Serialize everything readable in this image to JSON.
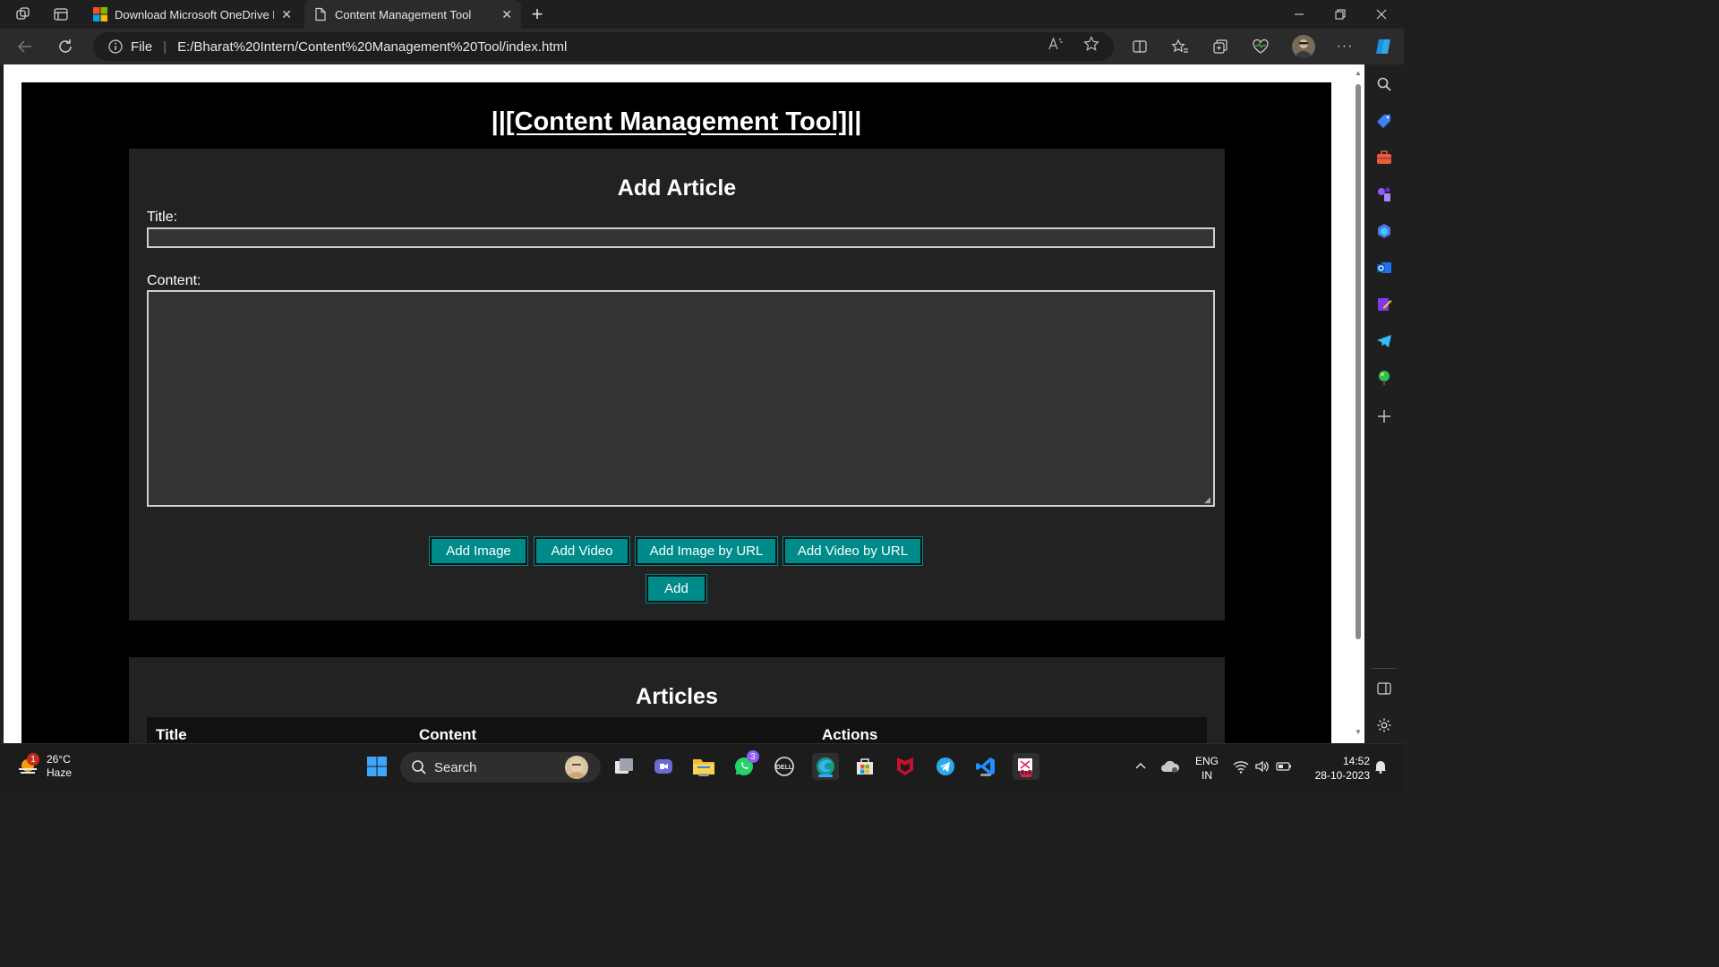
{
  "browser": {
    "tabs": [
      {
        "label": "Download Microsoft OneDrive M",
        "close": "✕",
        "active": false
      },
      {
        "label": "Content Management Tool",
        "close": "✕",
        "active": true
      }
    ],
    "new_tab": "+",
    "address": {
      "scheme_label": "File",
      "url": "E:/Bharat%20Intern/Content%20Management%20Tool/index.html"
    },
    "more_label": "···"
  },
  "page": {
    "site_title": "||[Content Management Tool]||",
    "form": {
      "heading": "Add Article",
      "title_label": "Title:",
      "title_value": "",
      "content_label": "Content:",
      "content_value": "",
      "buttons": {
        "add_image": "Add Image",
        "add_video": "Add Video",
        "add_image_url": "Add Image by URL",
        "add_video_url": "Add Video by URL",
        "add": "Add"
      }
    },
    "articles": {
      "heading": "Articles",
      "columns": [
        "Title",
        "Content",
        "Actions"
      ]
    }
  },
  "taskbar": {
    "weather": {
      "temp": "26°C",
      "condition": "Haze",
      "badge": "1"
    },
    "search_placeholder": "Search",
    "whatsapp_badge": "3",
    "language": {
      "line1": "ENG",
      "line2": "IN"
    },
    "clock": {
      "time": "14:52",
      "date": "28-10-2023"
    }
  },
  "colors": {
    "button": "#008b8b",
    "panel": "#222222",
    "page_bg": "#000000",
    "chrome": "#1f1f1f"
  }
}
